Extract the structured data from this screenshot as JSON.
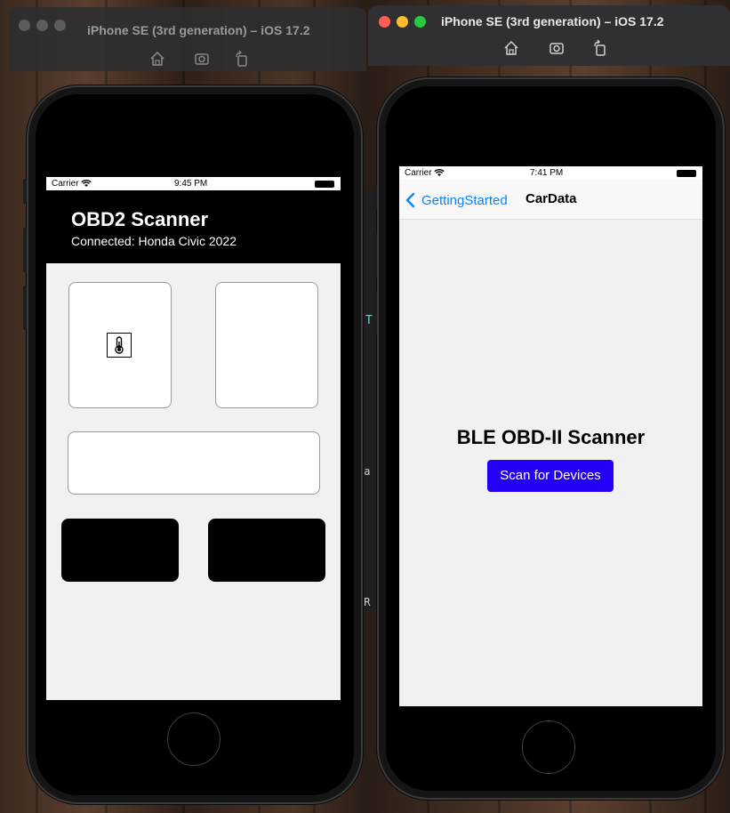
{
  "left_sim": {
    "window_title": "iPhone SE (3rd generation) – iOS 17.2",
    "status_bar": {
      "carrier": "Carrier",
      "time": "9:45 PM"
    },
    "header": {
      "title": "OBD2 Scanner",
      "subtitle": "Connected: Honda Civic 2022"
    },
    "tiles": [
      {
        "icon": "thermometer-icon"
      },
      {
        "icon": ""
      }
    ]
  },
  "right_sim": {
    "window_title": "iPhone SE (3rd generation) – iOS 17.2",
    "status_bar": {
      "carrier": "Carrier",
      "time": "7:41 PM"
    },
    "nav": {
      "back_label": "GettingStarted",
      "title": "CarData"
    },
    "main": {
      "heading": "BLE OBD-II Scanner",
      "scan_button": "Scan for Devices"
    }
  },
  "background_code_fragments": [
    "T",
    "ga",
    "OR"
  ],
  "colors": {
    "traffic_red": "#ff5f57",
    "traffic_yellow": "#febc2e",
    "traffic_green": "#28c840",
    "ios_blue": "#0a84ff",
    "scan_button": "#2300f5"
  }
}
